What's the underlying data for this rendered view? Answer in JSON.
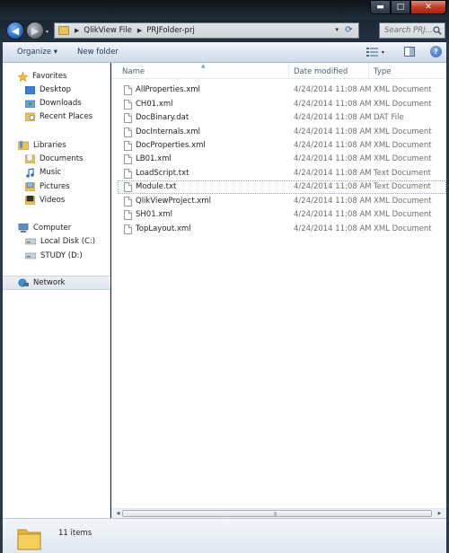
{
  "window": {
    "minimize_glyph": "▬",
    "maximize_glyph": "□",
    "close_glyph": "✕"
  },
  "address": {
    "back_glyph": "◀",
    "forward_glyph": "▶",
    "recent_glyph": "▾",
    "separator_glyph": "▶",
    "breadcrumbs": [
      "QlikView File",
      "PRJFolder-prj"
    ],
    "dropdown_glyph": "▾",
    "refresh_glyph": "⟳"
  },
  "search": {
    "placeholder": "Search PRJ..."
  },
  "toolbar": {
    "organize_label": "Organize ▾",
    "new_folder_label": "New folder",
    "help_label": "?"
  },
  "navigation": {
    "favorites": {
      "label": "Favorites",
      "items": [
        "Desktop",
        "Downloads",
        "Recent Places"
      ]
    },
    "libraries": {
      "label": "Libraries",
      "items": [
        "Documents",
        "Music",
        "Pictures",
        "Videos"
      ]
    },
    "computer": {
      "label": "Computer",
      "items": [
        "Local Disk (C:)",
        "STUDY (D:)"
      ]
    },
    "network": {
      "label": "Network"
    }
  },
  "columns": {
    "name": "Name",
    "date_modified": "Date modified",
    "type": "Type"
  },
  "files": [
    {
      "name": "AllProperties.xml",
      "date": "4/24/2014 11:08 AM",
      "type": "XML Document"
    },
    {
      "name": "CH01.xml",
      "date": "4/24/2014 11:08 AM",
      "type": "XML Document"
    },
    {
      "name": "DocBinary.dat",
      "date": "4/24/2014 11:08 AM",
      "type": "DAT File"
    },
    {
      "name": "DocInternals.xml",
      "date": "4/24/2014 11:08 AM",
      "type": "XML Document"
    },
    {
      "name": "DocProperties.xml",
      "date": "4/24/2014 11:08 AM",
      "type": "XML Document"
    },
    {
      "name": "LB01.xml",
      "date": "4/24/2014 11:08 AM",
      "type": "XML Document"
    },
    {
      "name": "LoadScript.txt",
      "date": "4/24/2014 11:08 AM",
      "type": "Text Document"
    },
    {
      "name": "Module.txt",
      "date": "4/24/2014 11:08 AM",
      "type": "Text Document"
    },
    {
      "name": "QlikViewProject.xml",
      "date": "4/24/2014 11:08 AM",
      "type": "XML Document"
    },
    {
      "name": "SH01.xml",
      "date": "4/24/2014 11:08 AM",
      "type": "XML Document"
    },
    {
      "name": "TopLayout.xml",
      "date": "4/24/2014 11:08 AM",
      "type": "XML Document"
    }
  ],
  "status": {
    "item_count": "11 items"
  },
  "colors": {
    "title_bar": "#0d1318",
    "command_bar": "#dde6f1",
    "close_button": "#c03622",
    "link_text": "#1e395b"
  }
}
